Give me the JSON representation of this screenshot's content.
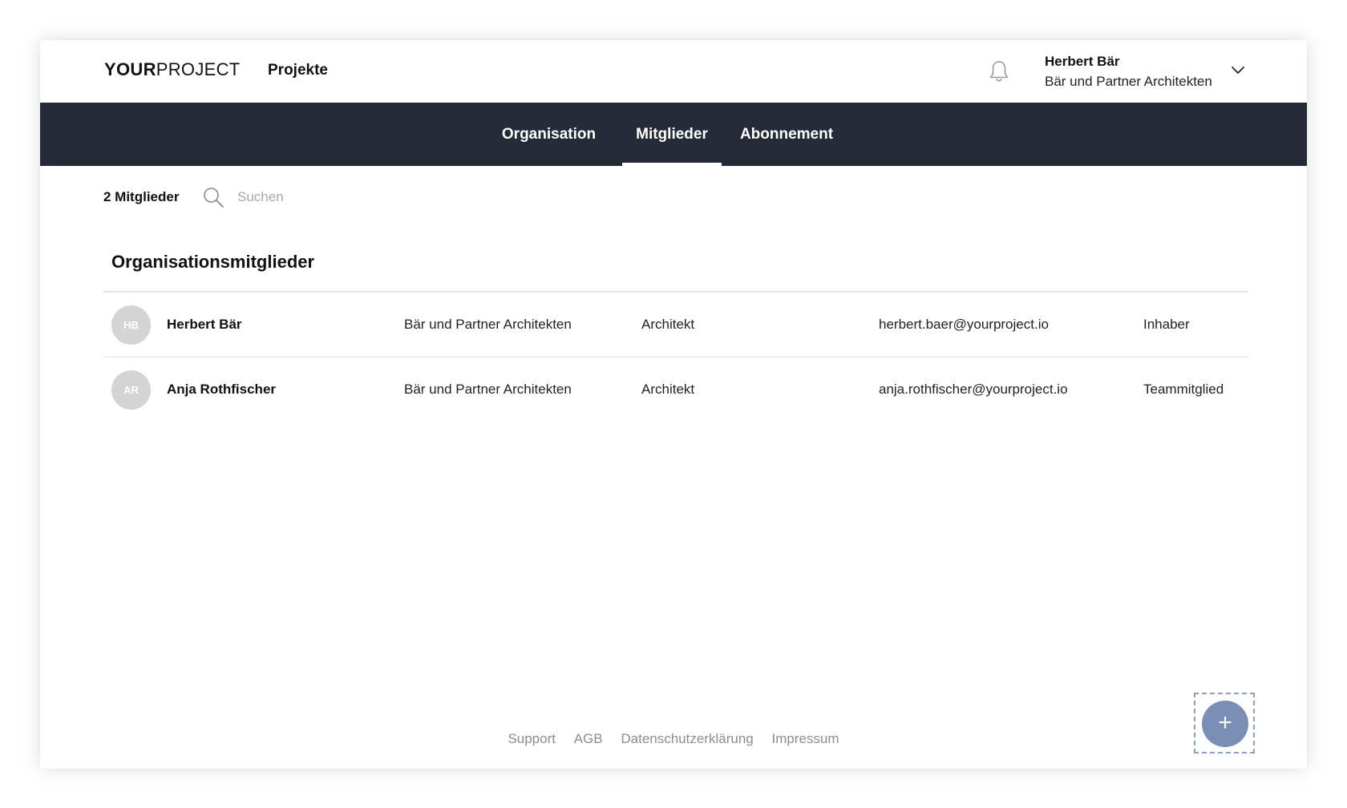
{
  "header": {
    "logo_bold": "YOUR",
    "logo_light": "PROJECT",
    "nav_projects": "Projekte",
    "user": {
      "name": "Herbert Bär",
      "organization": "Bär und Partner Architekten"
    },
    "icons": {
      "notifications": "bell-icon",
      "account_menu": "chevron-down-icon"
    }
  },
  "tabs": [
    {
      "label": "Organisation",
      "active": false
    },
    {
      "label": "Mitglieder",
      "active": true
    },
    {
      "label": "Abonnement",
      "active": false
    }
  ],
  "toolbar": {
    "member_count": "2 Mitglieder",
    "search_placeholder": "Suchen",
    "search_value": "",
    "search_icon": "search-icon"
  },
  "section": {
    "title": "Organisationsmitglieder"
  },
  "members": [
    {
      "initials": "HB",
      "name": "Herbert Bär",
      "company": "Bär und Partner Architekten",
      "role": "Architekt",
      "email": "herbert.baer@yourproject.io",
      "status": "Inhaber"
    },
    {
      "initials": "AR",
      "name": "Anja Rothfischer",
      "company": "Bär und Partner Architekten",
      "role": "Architekt",
      "email": "anja.rothfischer@yourproject.io",
      "status": "Teammitglied"
    }
  ],
  "footer": {
    "links": [
      "Support",
      "AGB",
      "Datenschutzerklärung",
      "Impressum"
    ]
  },
  "fab": {
    "label": "+",
    "icon": "plus-icon"
  },
  "colors": {
    "tabbar_bg": "#242b36",
    "fab_bg": "#7b8fb4",
    "avatar_bg": "#d4d4d4",
    "footer_link": "#8d8d8d"
  }
}
